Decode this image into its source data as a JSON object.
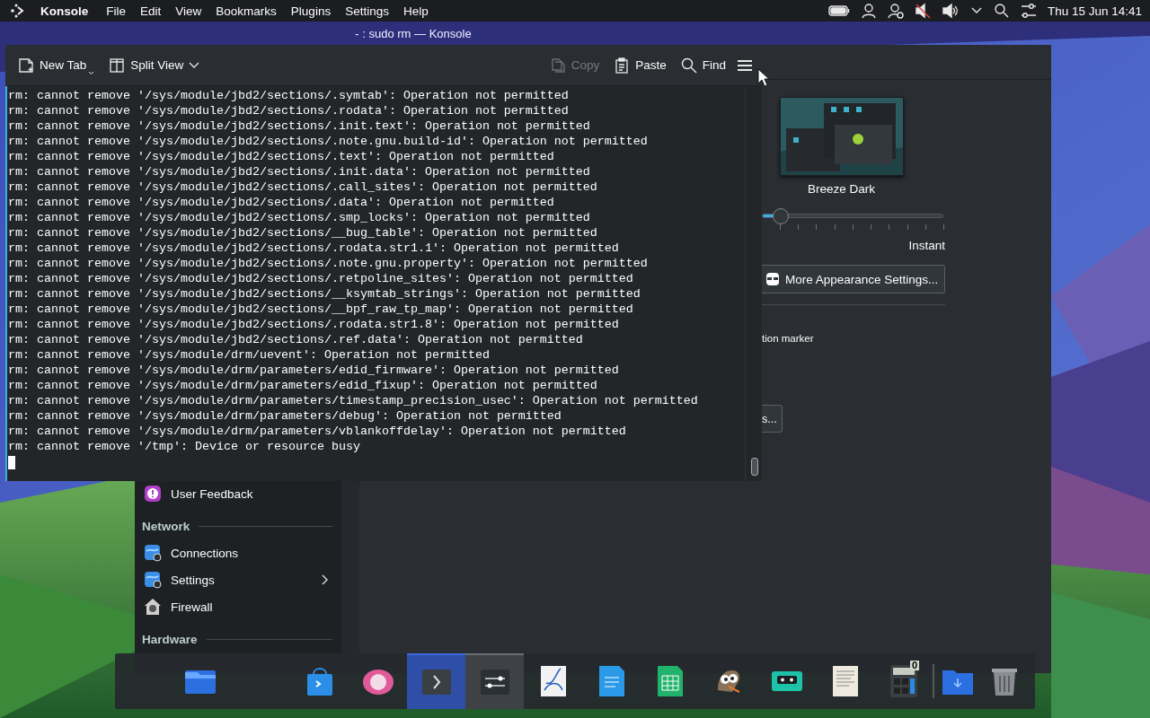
{
  "top_panel": {
    "app_name": "Konsole",
    "menus": [
      "File",
      "Edit",
      "View",
      "Bookmarks",
      "Plugins",
      "Settings",
      "Help"
    ],
    "clock": "Thu 15 Jun 14:41"
  },
  "settings_window": {
    "theme": {
      "name": "Breeze Dark"
    },
    "animation_slider": {
      "level": 0.1,
      "label": "Instant"
    },
    "more_button": "More Appearance Settings...",
    "partial_label": "tion marker",
    "partial_button": "s...",
    "sidebar": [
      {
        "kind": "item",
        "label": "User Feedback",
        "expandable": false
      },
      {
        "kind": "header",
        "label": "Network"
      },
      {
        "kind": "item",
        "label": "Connections",
        "expandable": false
      },
      {
        "kind": "item",
        "label": "Settings",
        "expandable": true
      },
      {
        "kind": "item",
        "label": "Firewall",
        "expandable": false
      },
      {
        "kind": "header",
        "label": "Hardware"
      }
    ]
  },
  "konsole": {
    "title": "- : sudo rm — Konsole",
    "toolbar": [
      {
        "label": "New Tab",
        "disabled": false
      },
      {
        "label": "Split View",
        "disabled": false
      },
      {
        "label": "Copy",
        "disabled": true
      },
      {
        "label": "Paste",
        "disabled": false
      },
      {
        "label": "Find",
        "disabled": false
      }
    ],
    "lines": [
      "rm: cannot remove '/sys/module/jbd2/sections/.symtab': Operation not permitted",
      "rm: cannot remove '/sys/module/jbd2/sections/.rodata': Operation not permitted",
      "rm: cannot remove '/sys/module/jbd2/sections/.init.text': Operation not permitted",
      "rm: cannot remove '/sys/module/jbd2/sections/.note.gnu.build-id': Operation not permitted",
      "rm: cannot remove '/sys/module/jbd2/sections/.text': Operation not permitted",
      "rm: cannot remove '/sys/module/jbd2/sections/.init.data': Operation not permitted",
      "rm: cannot remove '/sys/module/jbd2/sections/.call_sites': Operation not permitted",
      "rm: cannot remove '/sys/module/jbd2/sections/.data': Operation not permitted",
      "rm: cannot remove '/sys/module/jbd2/sections/.smp_locks': Operation not permitted",
      "rm: cannot remove '/sys/module/jbd2/sections/__bug_table': Operation not permitted",
      "rm: cannot remove '/sys/module/jbd2/sections/.rodata.str1.1': Operation not permitted",
      "rm: cannot remove '/sys/module/jbd2/sections/.note.gnu.property': Operation not permitted",
      "rm: cannot remove '/sys/module/jbd2/sections/.retpoline_sites': Operation not permitted",
      "rm: cannot remove '/sys/module/jbd2/sections/__ksymtab_strings': Operation not permitted",
      "rm: cannot remove '/sys/module/jbd2/sections/__bpf_raw_tp_map': Operation not permitted",
      "rm: cannot remove '/sys/module/jbd2/sections/.rodata.str1.8': Operation not permitted",
      "rm: cannot remove '/sys/module/jbd2/sections/.ref.data': Operation not permitted",
      "rm: cannot remove '/sys/module/drm/uevent': Operation not permitted",
      "rm: cannot remove '/sys/module/drm/parameters/edid_firmware': Operation not permitted",
      "rm: cannot remove '/sys/module/drm/parameters/edid_fixup': Operation not permitted",
      "rm: cannot remove '/sys/module/drm/parameters/timestamp_precision_usec': Operation not permitted",
      "rm: cannot remove '/sys/module/drm/parameters/debug': Operation not permitted",
      "rm: cannot remove '/sys/module/drm/parameters/vblankoffdelay': Operation not permitted",
      "rm: cannot remove '/tmp': Device or resource busy"
    ]
  },
  "dock": {
    "items": [
      {
        "selected": false,
        "open": false
      },
      {
        "selected": false,
        "open": false
      },
      {
        "selected": false,
        "open": false
      },
      {
        "selected": true,
        "open": true
      },
      {
        "selected": false,
        "open": true
      },
      {
        "selected": false,
        "open": false
      },
      {
        "selected": false,
        "open": false
      },
      {
        "selected": false,
        "open": false
      },
      {
        "selected": false,
        "open": false
      },
      {
        "selected": false,
        "open": false
      },
      {
        "selected": false,
        "open": false
      },
      {
        "selected": false,
        "open": false,
        "display": "0"
      },
      {
        "selected": false,
        "open": false
      },
      {
        "selected": false,
        "open": false
      }
    ]
  }
}
